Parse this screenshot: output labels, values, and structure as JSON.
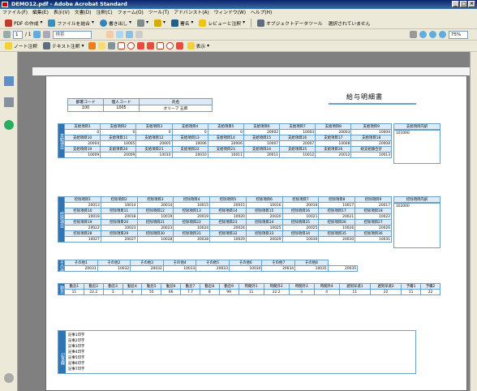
{
  "window": {
    "title": "DEMO12.pdf - Adobe Acrobat Standard"
  },
  "menu": [
    "ファイル(F)",
    "編集(E)",
    "表示(V)",
    "文書(D)",
    "注釈(C)",
    "フォーム(O)",
    "ツール(T)",
    "アドバンスト(A)",
    "ウィンドウ(W)",
    "ヘルプ(H)"
  ],
  "toolbar1": {
    "pdf_create": "PDF の作成",
    "combine": "ファイルを結合",
    "export": "書き出し",
    "sign": "署名",
    "review": "レビューと注釈",
    "object_tool": "オブジェクトデータツール",
    "not_selected": "選択されていません"
  },
  "toolbar2": {
    "page_current": "1",
    "page_total": "/ 1",
    "find": "検索",
    "zoom": "75%"
  },
  "toolbar3": {
    "note": "ノート注釈",
    "text_note": "テキスト注釈",
    "display": "表示"
  },
  "doc": {
    "title": "給与明細書",
    "header": {
      "labels": [
        "部署コード",
        "個人コード",
        "氏名"
      ],
      "values": [
        "100",
        "1005",
        "オリーブ 五郎"
      ]
    },
    "pay": {
      "side": "支給項目",
      "rows": [
        {
          "labels": [
            "支給項目1",
            "支給項目2",
            "支給項目3",
            "支給項目4",
            "支給項目5",
            "支給項目6",
            "支給項目7",
            "支給項目8",
            "支給項目9"
          ],
          "values": [
            "0",
            "0",
            "0",
            "0",
            "0",
            "20002",
            "10003",
            "20003",
            "10004"
          ]
        },
        {
          "labels": [
            "支給項目10",
            "支給項目11",
            "支給項目12",
            "支給項目13",
            "支給項目14",
            "支給項目15",
            "支給項目16",
            "支給項目17",
            "支給項目18"
          ],
          "values": [
            "20004",
            "10005",
            "20005",
            "10006",
            "20006",
            "10007",
            "20007",
            "10008",
            "20008"
          ]
        },
        {
          "labels": [
            "支給項目19",
            "支給項目20",
            "支給項目21",
            "支給項目22",
            "支給項目23",
            "支給項目24",
            "支給項目25",
            "支給項目26",
            "総支給額合計"
          ],
          "values": [
            "10009",
            "20009",
            "10010",
            "20010",
            "10011",
            "20011",
            "10012",
            "20012",
            "10013"
          ]
        }
      ],
      "note_header": "支給項目内訳",
      "note": "101000"
    },
    "deduct": {
      "side": "控除項目",
      "rows": [
        {
          "labels": [
            "控除項目1",
            "控除項目2",
            "控除項目3",
            "控除項目4",
            "控除項目5",
            "控除項目6",
            "控除項目7",
            "控除項目8",
            "控除項目9"
          ],
          "values": [
            "20013",
            "10014",
            "20014",
            "10015",
            "20015",
            "10016",
            "20016",
            "10017",
            "20017"
          ]
        },
        {
          "labels": [
            "控除項目10",
            "控除項目11",
            "控除項目12",
            "控除項目13",
            "控除項目14",
            "控除項目15",
            "控除項目16",
            "控除項目17",
            "控除項目18"
          ],
          "values": [
            "10018",
            "20018",
            "10019",
            "20019",
            "10020",
            "20020",
            "10021",
            "20021",
            "10022"
          ]
        },
        {
          "labels": [
            "控除項目19",
            "控除項目20",
            "控除項目21",
            "控除項目22",
            "控除項目23",
            "控除項目24",
            "控除項目25",
            "控除項目26",
            "控除項目27"
          ],
          "values": [
            "20022",
            "10023",
            "20023",
            "10024",
            "20024",
            "10025",
            "20025",
            "10026",
            "20026"
          ]
        },
        {
          "labels": [
            "控除項目28",
            "控除項目29",
            "控除項目30",
            "控除項目31",
            "控除項目32",
            "控除項目33",
            "控除項目34",
            "控除項目35",
            "控除項目36"
          ],
          "values": [
            "10027",
            "20027",
            "10028",
            "20028",
            "10029",
            "20029",
            "10030",
            "20030",
            "10031"
          ]
        }
      ],
      "note_header": "控除項目内訳",
      "note": "102000"
    },
    "other": {
      "side": "その他",
      "labels": [
        "その他1",
        "その他2",
        "その他3",
        "その他4",
        "その他5",
        "その他6",
        "その他7",
        "その他8"
      ],
      "values": [
        "20031",
        "10032",
        "20032",
        "10033",
        "20033",
        "10034",
        "20034",
        "10035",
        "20035"
      ]
    },
    "attendance": {
      "side": "勤怠",
      "labels": [
        "勤怠1",
        "勤怠2",
        "勤怠3",
        "勤怠4",
        "勤怠5",
        "勤怠6",
        "勤怠7",
        "勤怠8",
        "勤怠9",
        "時間外1",
        "時間外2",
        "時間外3",
        "時間外4",
        "遅刻早退1",
        "遅刻早退2",
        "予備1",
        "予備2"
      ],
      "values": [
        "11",
        "22.2",
        "3",
        "4",
        "55",
        "66",
        "7.7",
        "8",
        "99",
        "11",
        "22.2",
        "3",
        "4",
        "11",
        "22",
        "11",
        "22"
      ]
    },
    "memo": {
      "side": "記事欄",
      "lines": [
        "記事1印字",
        "記事2印字",
        "記事3印字",
        "記事4印字",
        "記事5印字",
        "記事6印字",
        "記事7印字"
      ]
    }
  },
  "colors": {
    "accent": "#2d75b4",
    "header_bg": "#dcebf7",
    "border": "#6aa0c8"
  }
}
